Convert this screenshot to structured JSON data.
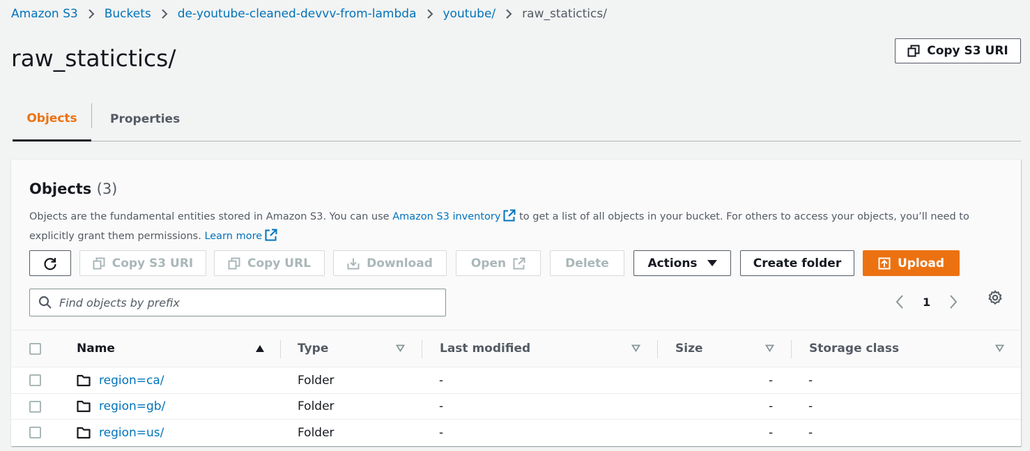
{
  "breadcrumb": {
    "items": [
      "Amazon S3",
      "Buckets",
      "de-youtube-cleaned-devvv-from-lambda",
      "youtube/"
    ],
    "current": "raw_statictics/"
  },
  "page": {
    "title": "raw_statictics/",
    "copy_s3_uri_label": "Copy S3 URI"
  },
  "tabs": [
    {
      "label": "Objects",
      "active": true
    },
    {
      "label": "Properties",
      "active": false
    }
  ],
  "objects_panel": {
    "title": "Objects",
    "count": "(3)",
    "desc_part1": "Objects are the fundamental entities stored in Amazon S3. You can use ",
    "desc_link1": "Amazon S3 inventory",
    "desc_part2": " to get a list of all objects in your bucket. For others to access your objects, you’ll need to explicitly grant them permissions. ",
    "desc_link2": "Learn more"
  },
  "toolbar": {
    "copy_s3_uri": "Copy S3 URI",
    "copy_url": "Copy URL",
    "download": "Download",
    "open": "Open",
    "delete": "Delete",
    "actions": "Actions",
    "create_folder": "Create folder",
    "upload": "Upload"
  },
  "search": {
    "placeholder": "Find objects by prefix",
    "value": ""
  },
  "pagination": {
    "current_page": "1"
  },
  "table": {
    "columns": [
      "Name",
      "Type",
      "Last modified",
      "Size",
      "Storage class"
    ],
    "rows": [
      {
        "name": "region=ca/",
        "type": "Folder",
        "last_modified": "-",
        "size": "-",
        "storage_class": "-"
      },
      {
        "name": "region=gb/",
        "type": "Folder",
        "last_modified": "-",
        "size": "-",
        "storage_class": "-"
      },
      {
        "name": "region=us/",
        "type": "Folder",
        "last_modified": "-",
        "size": "-",
        "storage_class": "-"
      }
    ]
  },
  "colors": {
    "link": "#0073bb",
    "accent": "#ec7211",
    "text": "#16191f",
    "muted": "#545b64"
  }
}
